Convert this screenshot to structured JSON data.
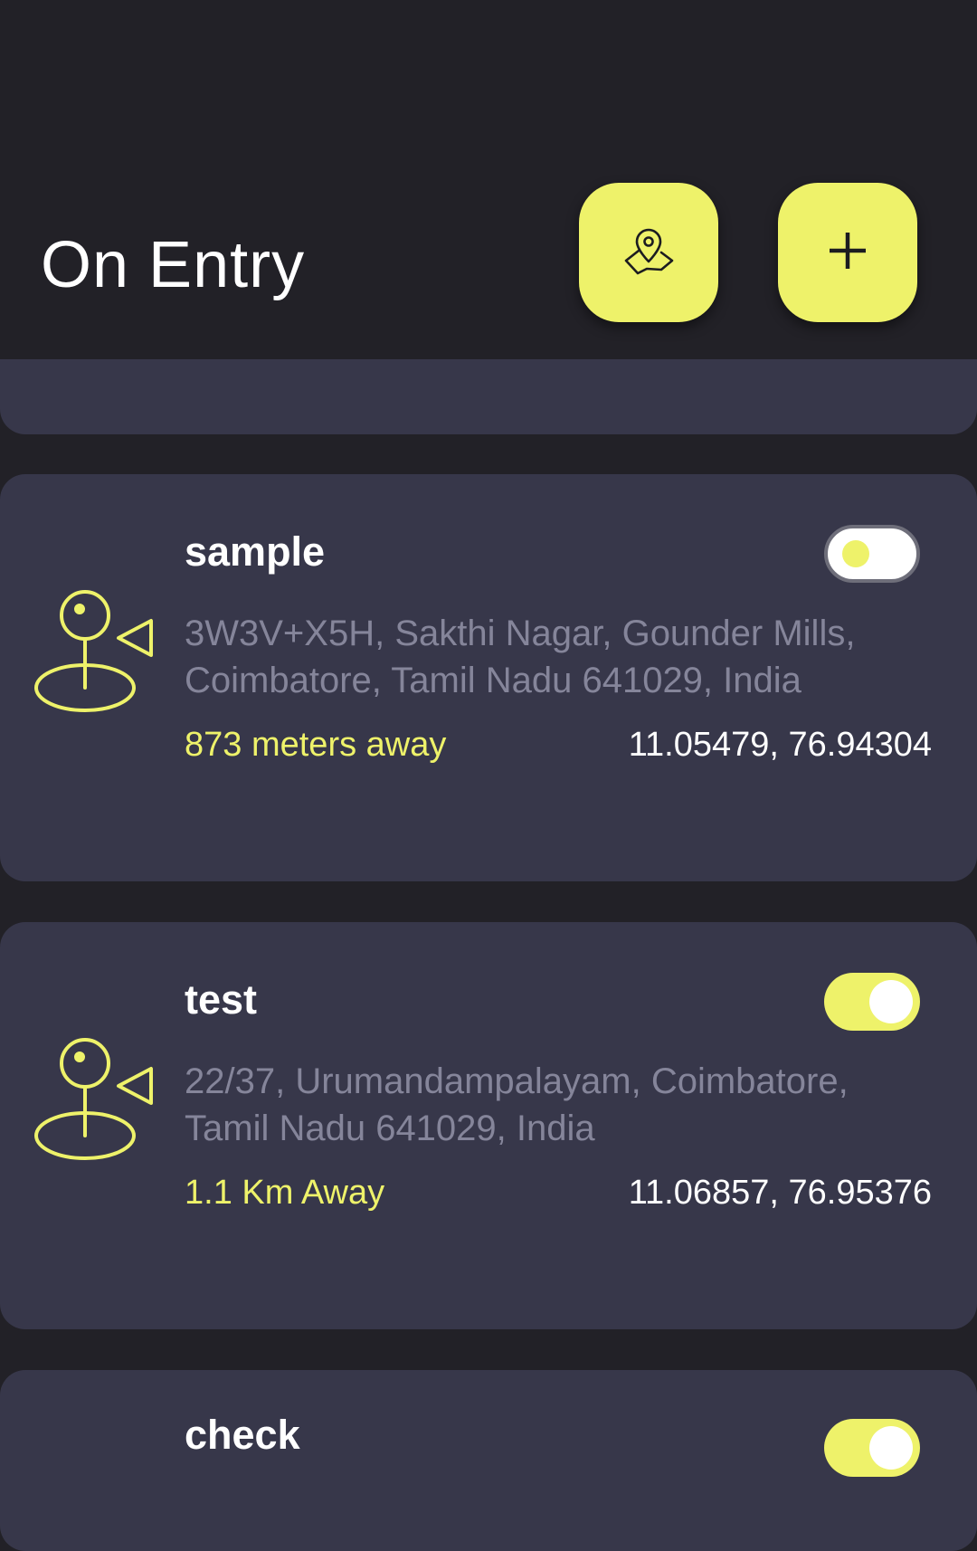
{
  "header": {
    "title": "On Entry",
    "map_button_icon": "map-pin-icon",
    "add_button_icon": "plus-icon"
  },
  "colors": {
    "accent": "#eef26a",
    "background": "#222127",
    "card": "#37374a",
    "address_text": "#85859a"
  },
  "locations": [
    {
      "name": "sample",
      "enabled": false,
      "address": "3W3V+X5H, Sakthi Nagar, Gounder Mills, Coimbatore, Tamil Nadu 641029, India",
      "distance": "873 meters away",
      "coords": "11.05479, 76.94304",
      "icon": "location-flag-icon"
    },
    {
      "name": "test",
      "enabled": true,
      "address": "22/37, Urumandampalayam, Coimbatore, Tamil Nadu 641029, India",
      "distance": "1.1 Km Away",
      "coords": "11.06857, 76.95376",
      "icon": "location-flag-icon"
    },
    {
      "name": "check",
      "enabled": true
    }
  ]
}
